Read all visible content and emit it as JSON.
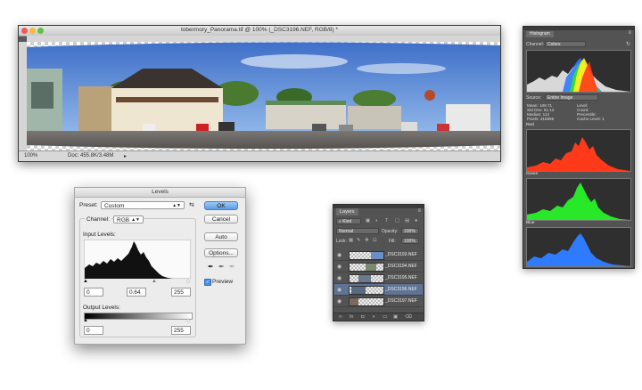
{
  "document": {
    "title": "tobermory_Panorama.tif @ 100% (_DSC3196.NEF, RGB/8) *",
    "zoom": "100%",
    "doc_size": "Doc: 455.8K/3.48M"
  },
  "levels": {
    "title": "Levels",
    "preset_label": "Preset:",
    "preset_value": "Custom",
    "channel_label": "Channel:",
    "channel_value": "RGB",
    "input_levels_label": "Input Levels:",
    "input_black": "0",
    "input_gamma": "0.64",
    "input_white": "255",
    "output_levels_label": "Output Levels:",
    "output_black": "0",
    "output_white": "255",
    "ok_label": "OK",
    "cancel_label": "Cancel",
    "auto_label": "Auto",
    "options_label": "Options...",
    "preview_label": "Preview",
    "preview_checked": true
  },
  "layers": {
    "tab": "Layers",
    "kind": "Kind",
    "blend_mode": "Normal",
    "opacity_label": "Opacity:",
    "opacity_value": "100%",
    "lock_label": "Lock:",
    "fill_label": "Fill:",
    "fill_value": "100%",
    "items": [
      {
        "name": "_DSC3193.NEF",
        "selected": false
      },
      {
        "name": "_DSC3194.NEF",
        "selected": false
      },
      {
        "name": "_DSC3195.NEF",
        "selected": false
      },
      {
        "name": "_DSC3196.NEF",
        "selected": true
      },
      {
        "name": "_DSC3197.NEF",
        "selected": false
      }
    ]
  },
  "histogram": {
    "tab": "Histogram",
    "channel_label": "Channel:",
    "channel_value": "Colors",
    "source_label": "Source:",
    "source_value": "Entire Image",
    "stats_left": [
      {
        "label": "Mean:",
        "value": "109.71"
      },
      {
        "label": "Std Dev:",
        "value": "61.12"
      },
      {
        "label": "Median:",
        "value": "113"
      },
      {
        "label": "Pixels:",
        "value": "315996"
      }
    ],
    "stats_right": [
      {
        "label": "Level:",
        "value": ""
      },
      {
        "label": "Count:",
        "value": ""
      },
      {
        "label": "Percentile:",
        "value": ""
      },
      {
        "label": "Cache Level:",
        "value": "1"
      }
    ],
    "channels": [
      "Red",
      "Green",
      "Blue"
    ],
    "colors": {
      "red": "#ff3a1a",
      "green": "#29e829",
      "blue": "#2f7bff",
      "yellow": "#ffee22"
    }
  }
}
